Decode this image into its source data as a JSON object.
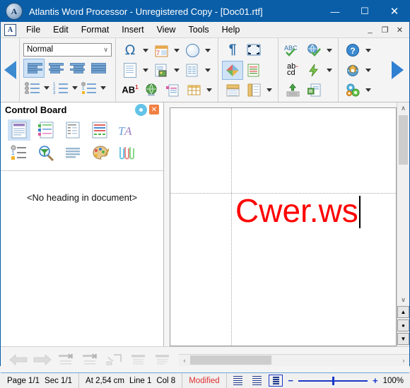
{
  "window": {
    "title": "Atlantis Word Processor - Unregistered Copy - [Doc01.rtf]",
    "app_icon": "A",
    "minimize": "—",
    "maximize": "☐",
    "close": "✕"
  },
  "mdi": {
    "icon": "A",
    "minimize": "_",
    "restore": "❐",
    "close": "✕"
  },
  "menu": {
    "items": [
      {
        "label": "File"
      },
      {
        "label": "Edit"
      },
      {
        "label": "Format"
      },
      {
        "label": "Insert"
      },
      {
        "label": "View"
      },
      {
        "label": "Tools"
      },
      {
        "label": "Help"
      }
    ]
  },
  "toolbar": {
    "nav_left": "prev-toolbar-arrow",
    "nav_right": "next-toolbar-arrow",
    "style_value": "Normal",
    "style_caret": "∨",
    "paragraph_group": {
      "align_left": "Align Left",
      "align_center": "Align Center",
      "align_right": "Align Right",
      "align_justify": "Justify",
      "bullets": "Bullets",
      "numbering": "Numbering",
      "multilevel": "Multilevel List"
    },
    "insert_group": {
      "symbol": "Ω",
      "date": "Insert Date",
      "time": "Insert Time",
      "page": "Insert Page",
      "picture": "Insert Picture",
      "columns": "Columns",
      "footnote": "AB",
      "footnote_sup": "1",
      "hyperlink": "Hyperlink",
      "page_break": "Page Break",
      "table": "Table"
    },
    "view_group": {
      "formatting_marks": "¶",
      "full_screen": "Full Screen",
      "color_scheme": "Color Scheme",
      "page_layout": "Page Layout",
      "horizontal_ruler": "Horizontal Ruler",
      "vertical_ruler": "Vertical Ruler"
    },
    "tools_group": {
      "spelling": "ABC",
      "web_check": "Web Check",
      "autocorrect": "ab-cd",
      "quick_actions": "Quick Actions",
      "keyboard": "Keyboard",
      "mail_merge": "Mail Merge"
    },
    "help_group": {
      "help": "?",
      "home_page": "Home Page",
      "options": "Options"
    }
  },
  "control_board": {
    "title": "Control Board",
    "settings_icon": "gear-icon",
    "close_icon": "✕",
    "row1": [
      {
        "name": "headings",
        "selected": true
      },
      {
        "name": "bookmarks",
        "selected": false
      },
      {
        "name": "document-map",
        "selected": false
      },
      {
        "name": "styles",
        "selected": false
      },
      {
        "name": "fonts",
        "selected": false
      }
    ],
    "row2": [
      {
        "name": "numbering",
        "selected": false
      },
      {
        "name": "find",
        "selected": false
      },
      {
        "name": "paragraphs",
        "selected": false
      },
      {
        "name": "colors",
        "selected": false
      },
      {
        "name": "clips",
        "selected": false
      }
    ],
    "empty_message": "<No heading in document>"
  },
  "document": {
    "text": "Cwer.ws",
    "text_color": "#ff0000",
    "scroll": {
      "up": "∧",
      "down": "∨",
      "browse_prev": "▲",
      "browse_object": "●",
      "browse_next": "▼",
      "left": "‹",
      "right": "›"
    }
  },
  "bottom_toolbar": {
    "items": [
      {
        "name": "go-back",
        "label": "Back"
      },
      {
        "name": "go-forward",
        "label": "Forward"
      },
      {
        "name": "delete-row",
        "label": "Delete Row"
      },
      {
        "name": "delete-column",
        "label": "Delete Column"
      },
      {
        "name": "merge-cells",
        "label": "Merge Cells"
      },
      {
        "name": "align-top",
        "label": "Align Top"
      },
      {
        "name": "align-bottom",
        "label": "Align Bottom"
      }
    ]
  },
  "statusbar": {
    "page": "Page 1/1",
    "section": "Sec 1/1",
    "position": "At 2,54 cm",
    "line": "Line 1",
    "column": "Col 8",
    "modified": "Modified",
    "views": [
      {
        "name": "draft-view",
        "active": false
      },
      {
        "name": "normal-view",
        "active": false
      },
      {
        "name": "page-view",
        "active": true
      }
    ],
    "zoom_out": "−",
    "zoom_in": "+",
    "zoom_level": "100%"
  }
}
